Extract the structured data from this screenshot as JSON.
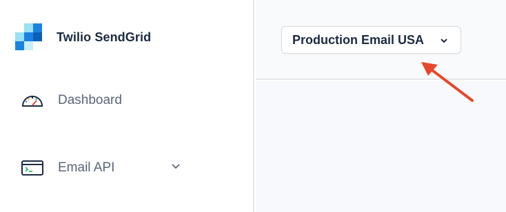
{
  "brand": {
    "name": "Twilio SendGrid",
    "icon": "sendgrid-logo"
  },
  "sidebar": {
    "items": [
      {
        "label": "Dashboard",
        "icon": "speedometer-icon"
      },
      {
        "label": "Email API",
        "icon": "terminal-window-icon",
        "expandable": true
      }
    ]
  },
  "header": {
    "environment_select": {
      "value": "Production Email USA",
      "icon": "chevron-down-icon"
    }
  },
  "annotation": {
    "icon": "red-arrow-icon",
    "color": "#e8472b"
  },
  "colors": {
    "brand_blue": "#1a82e2",
    "brand_light_blue": "#99e1f4",
    "text_dark": "#1b2a41",
    "text_muted": "#5a6478"
  }
}
